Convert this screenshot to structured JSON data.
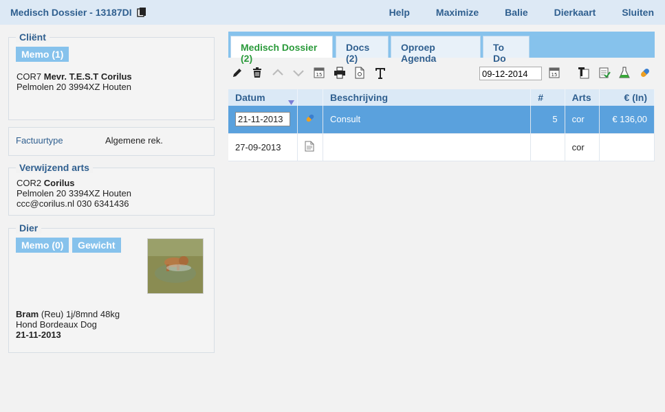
{
  "topbar": {
    "title": "Medisch Dossier - 13187DI",
    "nav": [
      "Help",
      "Maximize",
      "Balie",
      "Dierkaart",
      "Sluiten"
    ]
  },
  "client": {
    "legend": "Cliënt",
    "memo_label": "Memo (1)",
    "code": "COR7",
    "name": "Mevr. T.E.S.T Corilus",
    "address": "Pelmolen 20 3994XZ Houten"
  },
  "factuur": {
    "label": "Factuurtype",
    "value": "Algemene rek."
  },
  "verwijzend": {
    "legend": "Verwijzend arts",
    "code": "COR2",
    "name": "Corilus",
    "address": "Pelmolen 20 3394XZ Houten",
    "contact": "ccc@corilus.nl 030 6341436"
  },
  "dier": {
    "legend": "Dier",
    "memo_label": "Memo (0)",
    "gewicht_label": "Gewicht",
    "name": "Bram",
    "details": "(Reu) 1j/8mnd 48kg",
    "breed": "Hond Bordeaux Dog",
    "date": "21-11-2013"
  },
  "tabs": [
    "Medisch Dossier (2)",
    "Docs (2)",
    "Oproep Agenda",
    "To Do"
  ],
  "toolbar": {
    "date_value": "09-12-2014"
  },
  "table": {
    "headers": [
      "Datum",
      "",
      "Beschrijving",
      "#",
      "Arts",
      "€ (In)"
    ],
    "rows": [
      {
        "date": "21-11-2013",
        "icon": "pill-icon",
        "description": "Consult",
        "count": "5",
        "arts": "cor",
        "amount": "€ 136,00"
      },
      {
        "date": "27-09-2013",
        "icon": "document-icon",
        "description": "",
        "count": "",
        "arts": "cor",
        "amount": ""
      }
    ]
  },
  "colors": {
    "accent": "#86c2ec",
    "title_blue": "#2f5f8f",
    "active_tab": "#2a9a3a",
    "selected_row": "#5aa1dd"
  }
}
